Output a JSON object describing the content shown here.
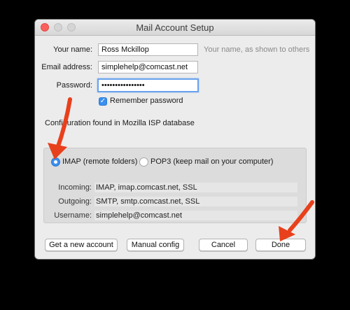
{
  "window": {
    "title": "Mail Account Setup"
  },
  "form": {
    "name_label": "Your name:",
    "name_value": "Ross Mckillop",
    "name_hint": "Your name, as shown to others",
    "email_label": "Email address:",
    "email_value": "simplehelp@comcast.net",
    "password_label": "Password:",
    "password_value": "••••••••••••••••",
    "remember_label": "Remember password",
    "remember_checked": true
  },
  "config_message": "Configuration found in Mozilla ISP database",
  "protocols": {
    "imap_label": "IMAP (remote folders)",
    "pop3_label": "POP3 (keep mail on your computer)",
    "selected": "imap"
  },
  "servers": {
    "incoming_label": "Incoming:",
    "incoming_value": "IMAP, imap.comcast.net, SSL",
    "outgoing_label": "Outgoing:",
    "outgoing_value": "SMTP, smtp.comcast.net, SSL",
    "username_label": "Username:",
    "username_value": "simplehelp@comcast.net"
  },
  "buttons": {
    "new_account": "Get a new account",
    "manual_config": "Manual config",
    "cancel": "Cancel",
    "done": "Done"
  },
  "colors": {
    "accent": "#3a8ff0",
    "annotation_arrow": "#e8401c",
    "close_button": "#fc605b"
  }
}
